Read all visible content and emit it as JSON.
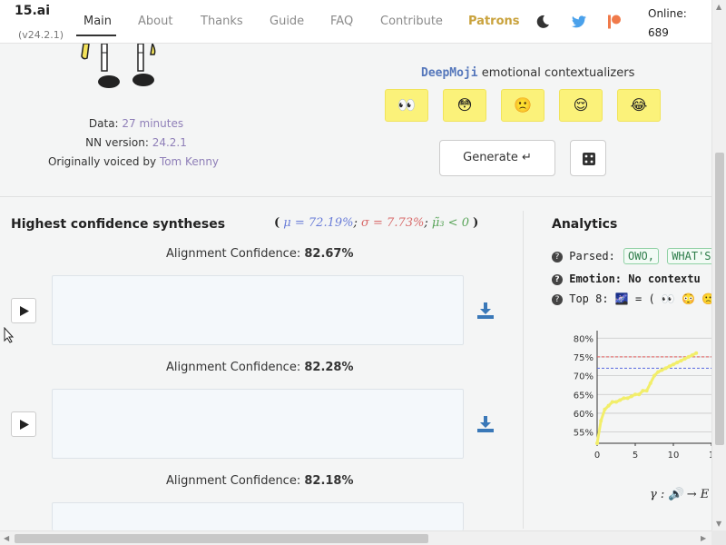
{
  "header": {
    "brand": "15.ai",
    "version": "(v24.2.1)",
    "nav": [
      "Main",
      "About",
      "Thanks",
      "Guide",
      "FAQ",
      "Contribute"
    ],
    "patrons": "Patrons",
    "online_label": "Online:",
    "online_count": "689",
    "icons": [
      "moon-icon",
      "twitter-icon",
      "patreon-icon"
    ]
  },
  "character_info": {
    "data_label": "Data:",
    "data_value": "27 minutes",
    "nn_label": "NN version:",
    "nn_value": "24.2.1",
    "voiced_label": "Originally voiced by",
    "voiced_value": "Tom Kenny"
  },
  "deepmoji": {
    "brand": "DeepMoji",
    "title": "emotional contextualizers",
    "emojis": [
      "👀",
      "😳",
      "🙁",
      "😌",
      "😂"
    ]
  },
  "actions": {
    "generate": "Generate ↵",
    "dice_icon": "dice-icon"
  },
  "syntheses": {
    "title": "Highest confidence syntheses",
    "stats": {
      "mu": "μ = 72.19%",
      "sigma": "σ = 7.73%",
      "mu3": "μ̃₃ < 0"
    },
    "results": [
      {
        "label": "Alignment Confidence:",
        "value": "82.67%"
      },
      {
        "label": "Alignment Confidence:",
        "value": "82.28%"
      },
      {
        "label": "Alignment Confidence:",
        "value": "82.18%"
      }
    ]
  },
  "analytics": {
    "title": "Analytics",
    "parsed_label": "Parsed:",
    "parsed_tokens": [
      "OWO,",
      "WHAT'S"
    ],
    "emotion_label": "Emotion: No contextu",
    "top8_label": "Top 8:",
    "top8_emojis": "🌌 = ( 👀 😳 🙁 =",
    "gamma": "γ : 🔊 → E"
  },
  "chart_data": {
    "type": "line",
    "x": [
      0,
      0.5,
      1,
      1.5,
      2,
      2.5,
      3,
      3.5,
      4,
      4.5,
      5,
      5.5,
      6,
      6.5,
      7,
      7.5,
      8,
      8.5,
      9,
      9.5,
      10,
      10.5,
      11,
      11.5,
      12,
      12.5,
      13
    ],
    "y": [
      52,
      58,
      61,
      62,
      63,
      63,
      63.5,
      64,
      64,
      64.5,
      65,
      65,
      66,
      66,
      68,
      70,
      71,
      71.5,
      72,
      72.5,
      73,
      73.5,
      74,
      74.5,
      75,
      75.5,
      76
    ],
    "xticks": [
      "0",
      "5",
      "10",
      "1"
    ],
    "yticks": [
      "55%",
      "60%",
      "65%",
      "70%",
      "75%",
      "80%"
    ],
    "ylim": [
      52,
      82
    ],
    "xlim": [
      0,
      15
    ],
    "ref_lines": [
      {
        "value": 75,
        "color": "#e05a5a"
      },
      {
        "value": 72,
        "color": "#5a6ae0"
      }
    ],
    "series_color": "#f2ee6a",
    "grid": true
  }
}
